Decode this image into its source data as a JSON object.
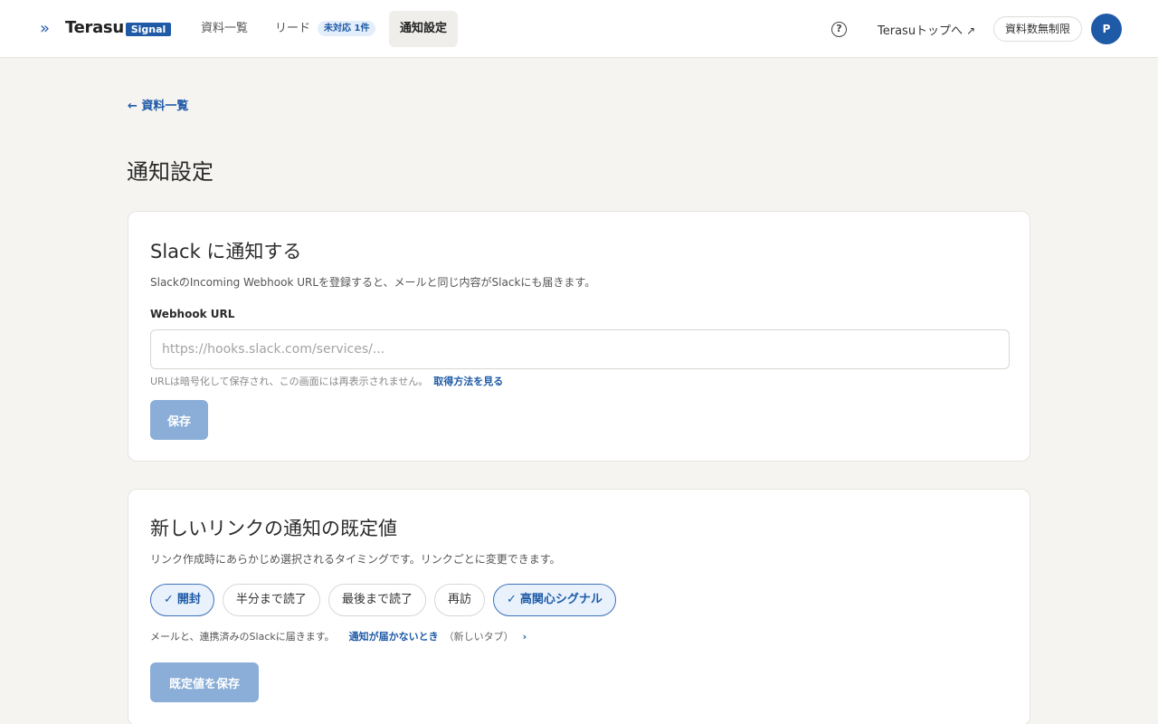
{
  "header": {
    "brand": "Terasu",
    "brand_badge": "Signal",
    "nav": [
      {
        "label": "資料一覧"
      },
      {
        "label": "リード",
        "badge": "未対応 1件"
      },
      {
        "label": "通知設定"
      }
    ],
    "help_icon": "question-circle-icon",
    "top_link": "Terasuトップへ",
    "top_link_icon": "↗",
    "plan": "資料数無制限",
    "avatar": "P"
  },
  "back_link": "← 資料一覧",
  "page_title": "通知設定",
  "slack_card": {
    "title": "Slack に通知する",
    "description": "SlackのIncoming Webhook URLを登録すると、メールと同じ内容がSlackにも届きます。",
    "field_label": "Webhook URL",
    "placeholder": "https://hooks.slack.com/services/...",
    "value": "",
    "hint": "URLは暗号化して保存され、この画面には再表示されません。",
    "hint_link": "取得方法を見る",
    "save": "保存"
  },
  "defaults_card": {
    "title": "新しいリンクの通知の既定値",
    "description": "リンク作成時にあらかじめ選択されるタイミングです。リンクごとに変更できます。",
    "chips": [
      {
        "label": "開封",
        "selected": true
      },
      {
        "label": "半分まで読了",
        "selected": false
      },
      {
        "label": "最後まで読了",
        "selected": false
      },
      {
        "label": "再訪",
        "selected": false
      },
      {
        "label": "高関心シグナル",
        "selected": true
      }
    ],
    "note": "メールと、連携済みのSlackに届きます。",
    "note_link": "通知が届かないとき",
    "note_sub": "（新しいタブ）",
    "note_chev": "›",
    "save": "既定値を保存"
  },
  "colors": {
    "accent": "#1e5aa6",
    "disabled_button": "#8aaed8",
    "background": "#f5f4f1"
  }
}
